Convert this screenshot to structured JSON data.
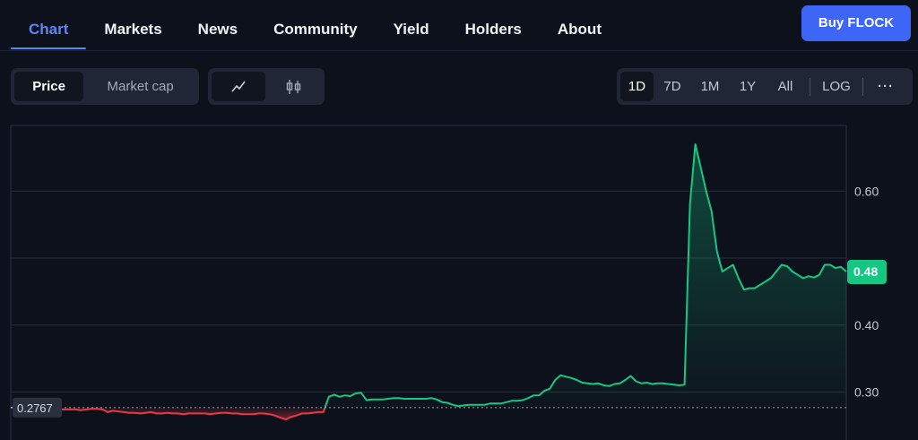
{
  "nav": {
    "tabs": [
      "Chart",
      "Markets",
      "News",
      "Community",
      "Yield",
      "Holders",
      "About"
    ],
    "active_tab": "Chart",
    "buy_button": "Buy FLOCK"
  },
  "controls": {
    "metric_options": [
      "Price",
      "Market cap"
    ],
    "metric_selected": "Price",
    "chart_type_icons": [
      "line-chart-icon",
      "candlestick-icon"
    ],
    "chart_type_selected": "line-chart-icon",
    "ranges": [
      "1D",
      "7D",
      "1M",
      "1Y",
      "All"
    ],
    "range_selected": "1D",
    "log_label": "LOG",
    "more_label": "···"
  },
  "colors": {
    "accent": "#5a86f5",
    "button": "#3d66f6",
    "up": "#16c784",
    "down": "#ea3943",
    "grid": "#262c3a"
  },
  "chart_data": {
    "type": "area",
    "y_ticks": [
      0.3,
      0.4,
      0.5,
      0.6
    ],
    "y_tick_labels": [
      "0.30",
      "0.40",
      "",
      "0.60"
    ],
    "ylim": [
      0.245,
      0.7
    ],
    "reference_value": 0.2767,
    "reference_label": "0.2767",
    "current_value": 0.48,
    "current_label": "0.48",
    "grid": true,
    "x_labels": [],
    "values": [
      0.2767,
      0.2767,
      0.2767,
      0.276,
      0.275,
      0.274,
      0.275,
      0.275,
      0.274,
      0.274,
      0.274,
      0.274,
      0.274,
      0.273,
      0.274,
      0.275,
      0.275,
      0.274,
      0.27,
      0.272,
      0.271,
      0.27,
      0.269,
      0.269,
      0.268,
      0.269,
      0.27,
      0.268,
      0.268,
      0.269,
      0.268,
      0.268,
      0.267,
      0.268,
      0.268,
      0.268,
      0.268,
      0.267,
      0.268,
      0.269,
      0.269,
      0.268,
      0.268,
      0.267,
      0.267,
      0.267,
      0.268,
      0.268,
      0.267,
      0.265,
      0.262,
      0.259,
      0.263,
      0.265,
      0.268,
      0.268,
      0.269,
      0.27,
      0.27,
      0.293,
      0.296,
      0.293,
      0.295,
      0.294,
      0.298,
      0.299,
      0.288,
      0.289,
      0.289,
      0.289,
      0.29,
      0.291,
      0.291,
      0.29,
      0.29,
      0.29,
      0.29,
      0.29,
      0.291,
      0.289,
      0.285,
      0.284,
      0.281,
      0.279,
      0.28,
      0.281,
      0.281,
      0.281,
      0.281,
      0.283,
      0.283,
      0.283,
      0.285,
      0.287,
      0.287,
      0.288,
      0.291,
      0.295,
      0.295,
      0.302,
      0.305,
      0.318,
      0.325,
      0.323,
      0.321,
      0.318,
      0.314,
      0.313,
      0.312,
      0.313,
      0.31,
      0.309,
      0.312,
      0.313,
      0.318,
      0.324,
      0.316,
      0.313,
      0.314,
      0.312,
      0.313,
      0.313,
      0.312,
      0.311,
      0.31,
      0.311,
      0.58,
      0.67,
      0.635,
      0.6,
      0.57,
      0.51,
      0.48,
      0.485,
      0.49,
      0.47,
      0.453,
      0.455,
      0.455,
      0.46,
      0.465,
      0.47,
      0.48,
      0.49,
      0.488,
      0.48,
      0.475,
      0.47,
      0.473,
      0.471,
      0.475,
      0.49,
      0.49,
      0.485,
      0.487,
      0.48
    ]
  }
}
